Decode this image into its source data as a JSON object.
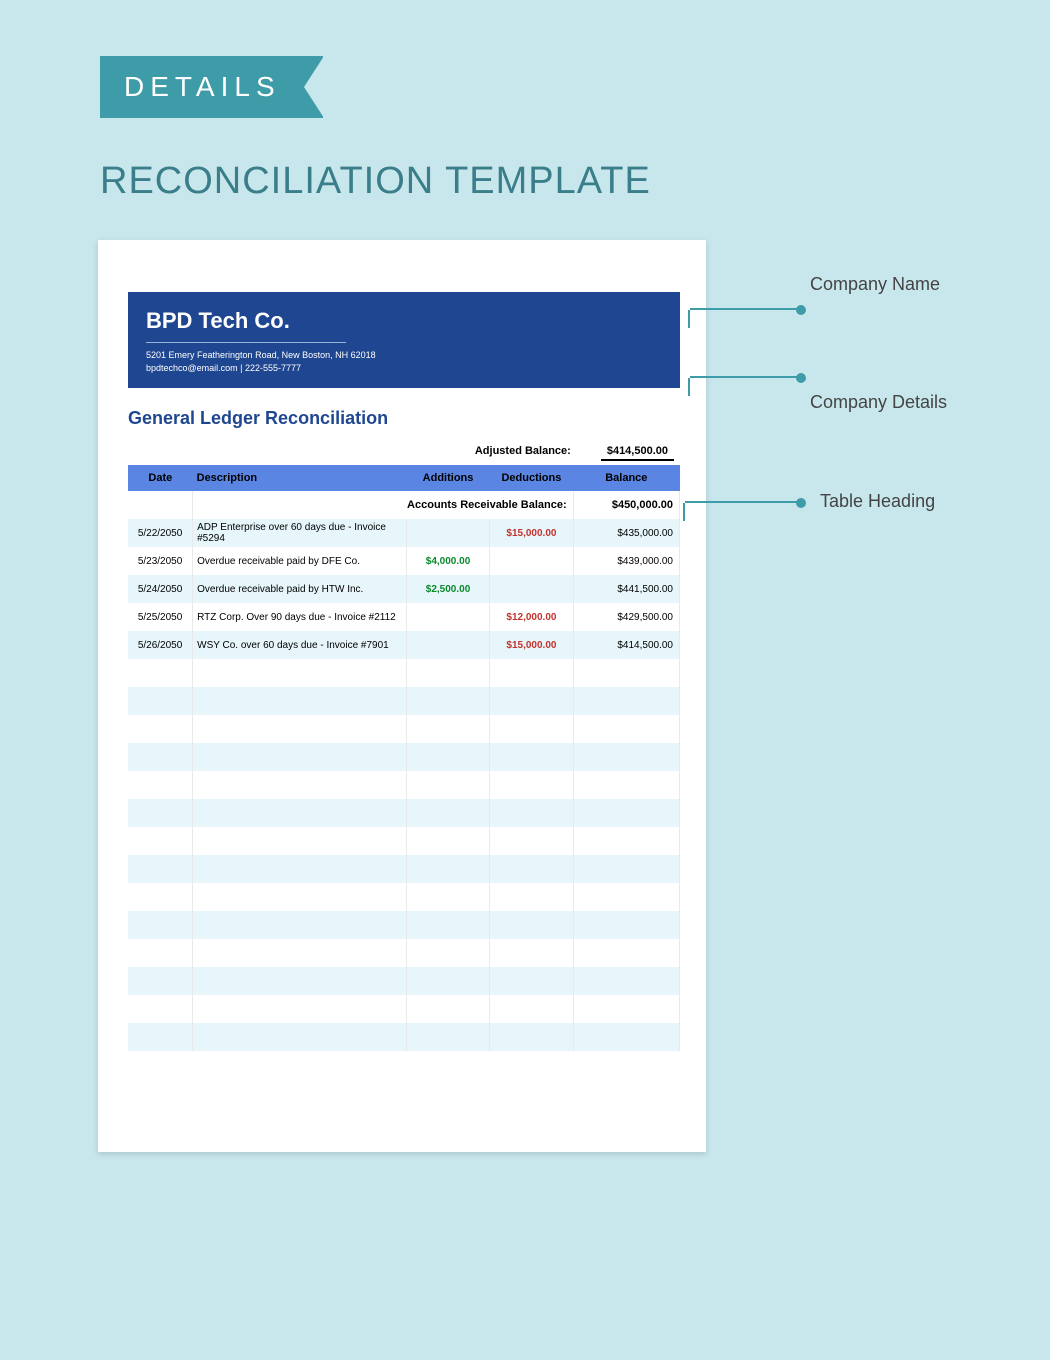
{
  "ribbon": "DETAILS",
  "page_title": "RECONCILIATION TEMPLATE",
  "company": {
    "name": "BPD Tech Co.",
    "address": "5201 Emery Featherington Road, New Boston, NH 62018",
    "contact": "bpdtechco@email.com | 222-555-7777"
  },
  "ledger_title": "General Ledger Reconciliation",
  "adjusted": {
    "label": "Adjusted Balance:",
    "value": "$414,500.00"
  },
  "columns": {
    "date": "Date",
    "desc": "Description",
    "add": "Additions",
    "ded": "Deductions",
    "bal": "Balance"
  },
  "ar_row": {
    "label": "Accounts Receivable Balance:",
    "value": "$450,000.00"
  },
  "rows": [
    {
      "date": "5/22/2050",
      "desc": "ADP Enterprise over 60 days due - Invoice #5294",
      "add": "",
      "ded": "$15,000.00",
      "bal": "$435,000.00"
    },
    {
      "date": "5/23/2050",
      "desc": "Overdue receivable paid by DFE Co.",
      "add": "$4,000.00",
      "ded": "",
      "bal": "$439,000.00"
    },
    {
      "date": "5/24/2050",
      "desc": "Overdue receivable paid by HTW Inc.",
      "add": "$2,500.00",
      "ded": "",
      "bal": "$441,500.00"
    },
    {
      "date": "5/25/2050",
      "desc": "RTZ Corp. Over 90 days due - Invoice #2112",
      "add": "",
      "ded": "$12,000.00",
      "bal": "$429,500.00"
    },
    {
      "date": "5/26/2050",
      "desc": "WSY Co. over 60 days due - Invoice #7901",
      "add": "",
      "ded": "$15,000.00",
      "bal": "$414,500.00"
    }
  ],
  "empty_rows": 14,
  "callouts": {
    "company_name": "Company Name",
    "company_details": "Company Details",
    "table_heading": "Table Heading"
  }
}
